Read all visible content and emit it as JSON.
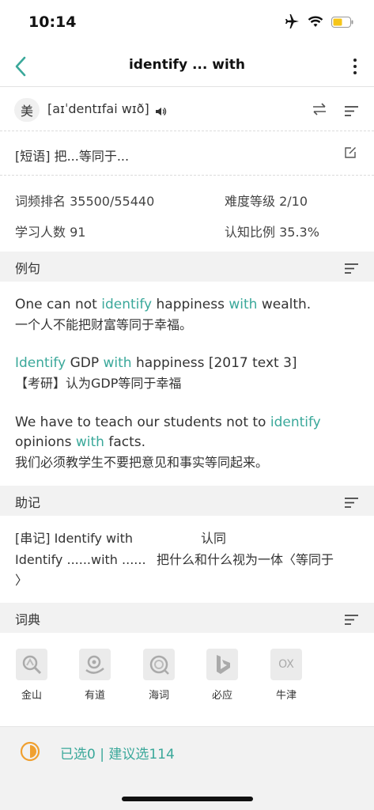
{
  "status_bar": {
    "time": "10:14"
  },
  "nav": {
    "title": "identify ... with"
  },
  "pronunciation": {
    "accent": "美",
    "phonetic": "[aɪˈdentɪfai wɪð]"
  },
  "definition": {
    "text": "[短语] 把...等同于..."
  },
  "stats": {
    "rank": "词频排名 35500/55440",
    "difficulty": "难度等级 2/10",
    "learners": "学习人数 91",
    "awareness": "认知比例 35.3%"
  },
  "sections": {
    "examples": "例句",
    "mnemonic": "助记",
    "dictionary": "词典"
  },
  "examples": [
    {
      "en_parts": [
        {
          "text": "One can not ",
          "hl": false
        },
        {
          "text": "identify",
          "hl": true
        },
        {
          "text": " happiness ",
          "hl": false
        },
        {
          "text": "with",
          "hl": true
        },
        {
          "text": " wealth.",
          "hl": false
        }
      ],
      "cn": "一个人不能把财富等同于幸福。"
    },
    {
      "en_parts": [
        {
          "text": "Identify",
          "hl": true
        },
        {
          "text": " GDP ",
          "hl": false
        },
        {
          "text": "with",
          "hl": true
        },
        {
          "text": " happiness [2017 text 3]",
          "hl": false
        }
      ],
      "cn": "【考研】认为GDP等同于幸福"
    },
    {
      "en_parts": [
        {
          "text": "We have to teach our students not to ",
          "hl": false
        },
        {
          "text": "identify",
          "hl": true
        },
        {
          "text": " opinions ",
          "hl": false
        },
        {
          "text": "with",
          "hl": true
        },
        {
          "text": " facts.",
          "hl": false
        }
      ],
      "cn": "我们必须教学生不要把意见和事实等同起来。"
    }
  ],
  "mnemonic": {
    "line1_left": "[串记] Identify with",
    "line1_right": "认同",
    "line2_left": "Identify ......with ......",
    "line2_right": "把什么和什么视为一体〈等同于",
    "line3": "〉"
  },
  "dictionaries": [
    {
      "label": "金山",
      "icon": "jinshan-logo-icon"
    },
    {
      "label": "有道",
      "icon": "youdao-logo-icon"
    },
    {
      "label": "海词",
      "icon": "haici-logo-icon"
    },
    {
      "label": "必应",
      "icon": "bing-logo-icon"
    },
    {
      "label": "牛津",
      "icon": "oxford-logo-icon",
      "logo_text": "OX"
    }
  ],
  "bottom": {
    "selection": "已选0 | 建议选114"
  },
  "colors": {
    "accent": "#3aa89a",
    "progress": "#f0a030",
    "battery": "#f5c518"
  }
}
